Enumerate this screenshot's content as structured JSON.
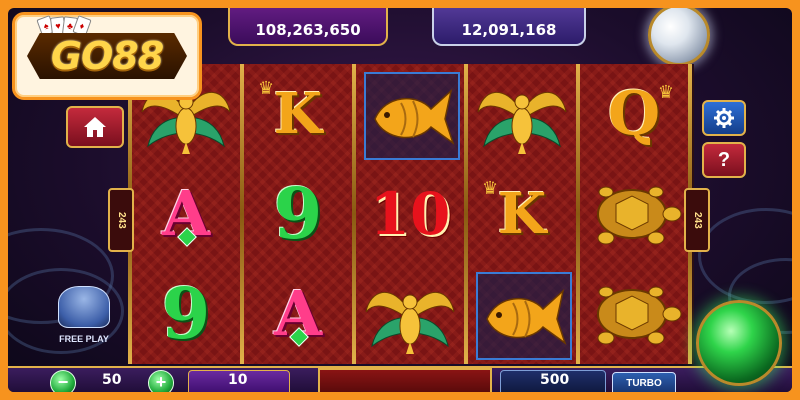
{
  "logo": {
    "text": "GO88"
  },
  "jackpots": {
    "grand": {
      "label": "",
      "value": "108,263,650"
    },
    "major": {
      "label": "",
      "value": "12,091,168"
    }
  },
  "ways": {
    "left": "243",
    "right": "243"
  },
  "free_play": {
    "label": "FREE PLAY"
  },
  "reels": [
    [
      "peacock",
      "A",
      "9"
    ],
    [
      "K",
      "9",
      "A"
    ],
    [
      "fish",
      "10",
      "peacock"
    ],
    [
      "peacock",
      "K",
      "fish"
    ],
    [
      "Q",
      "turtle",
      "turtle"
    ]
  ],
  "bottom_bar": {
    "lines": "50",
    "bet": "10",
    "total": "500",
    "turbo_label": "TURBO",
    "minus": "−",
    "plus": "+"
  },
  "icons": {
    "home": "home-icon",
    "settings": "gear-icon",
    "help": "question-icon",
    "spin": "spin-orb-icon"
  },
  "colors": {
    "frame": "#f7931e",
    "reel_bg": "#7a1414",
    "gold": "#e2b24a"
  }
}
